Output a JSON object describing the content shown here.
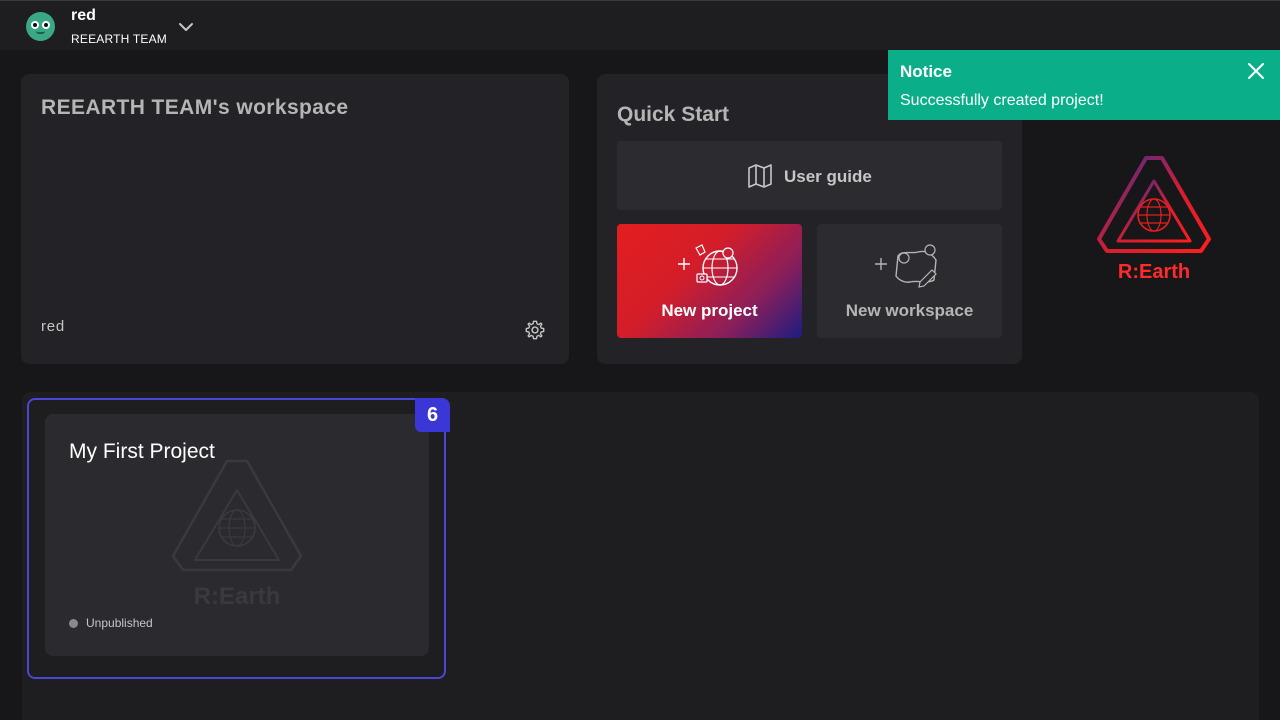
{
  "header": {
    "user_name": "red",
    "team_name": "REEARTH TEAM"
  },
  "workspace": {
    "title": "REEARTH TEAM's workspace",
    "member": "red"
  },
  "quick_start": {
    "title": "Quick Start",
    "user_guide_label": "User guide",
    "new_project_label": "New project",
    "new_workspace_label": "New workspace"
  },
  "logo": {
    "text": "R:Earth"
  },
  "notice": {
    "title": "Notice",
    "message": "Successfully created project!",
    "color": "#0aaf8a"
  },
  "projects": [
    {
      "title": "My First Project",
      "status": "Unpublished",
      "badge": "6"
    }
  ],
  "colors": {
    "background": "#171618",
    "card": "#232226",
    "accent_purple": "#4a46d8",
    "brand_red": "#e31f1f"
  }
}
